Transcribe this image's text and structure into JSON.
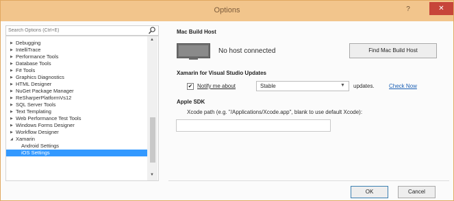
{
  "window": {
    "title": "Options",
    "help_label": "?",
    "close_label": "✕"
  },
  "search": {
    "placeholder": "Search Options (Ctrl+E)"
  },
  "tree": {
    "items": [
      {
        "label": "Debugging",
        "expanded": false
      },
      {
        "label": "IntelliTrace",
        "expanded": false
      },
      {
        "label": "Performance Tools",
        "expanded": false
      },
      {
        "label": "Database Tools",
        "expanded": false
      },
      {
        "label": "F# Tools",
        "expanded": false
      },
      {
        "label": "Graphics Diagnostics",
        "expanded": false
      },
      {
        "label": "HTML Designer",
        "expanded": false
      },
      {
        "label": "NuGet Package Manager",
        "expanded": false
      },
      {
        "label": "ReSharperPlatformVs12",
        "expanded": false
      },
      {
        "label": "SQL Server Tools",
        "expanded": false
      },
      {
        "label": "Text Templating",
        "expanded": false
      },
      {
        "label": "Web Performance Test Tools",
        "expanded": false
      },
      {
        "label": "Windows Forms Designer",
        "expanded": false
      },
      {
        "label": "Workflow Designer",
        "expanded": false
      },
      {
        "label": "Xamarin",
        "expanded": true
      },
      {
        "label": "Android Settings",
        "child": true
      },
      {
        "label": "iOS Settings",
        "child": true,
        "selected": true
      }
    ],
    "collapsed_glyph": "▶",
    "expanded_glyph": "◢",
    "scroll_up": "▲",
    "scroll_down": "▼"
  },
  "mac_build_host": {
    "heading": "Mac Build Host",
    "status": "No host connected",
    "find_button": "Find Mac Build Host"
  },
  "updates": {
    "heading": "Xamarin for Visual Studio Updates",
    "notify_label": "Notify me about",
    "notify_checked": true,
    "check_glyph": "✔",
    "channel": "Stable",
    "updates_label": "updates.",
    "check_now": "Check Now"
  },
  "apple_sdk": {
    "heading": "Apple SDK",
    "xcode_label": "Xcode path (e.g. \"/Applications/Xcode.app\", blank to use default Xcode):",
    "xcode_value": ""
  },
  "footer": {
    "ok": "OK",
    "cancel": "Cancel"
  },
  "colors": {
    "titlebar": "#f2c58c",
    "selection": "#3399ff",
    "link": "#1a5fb4",
    "close": "#c7453a"
  }
}
